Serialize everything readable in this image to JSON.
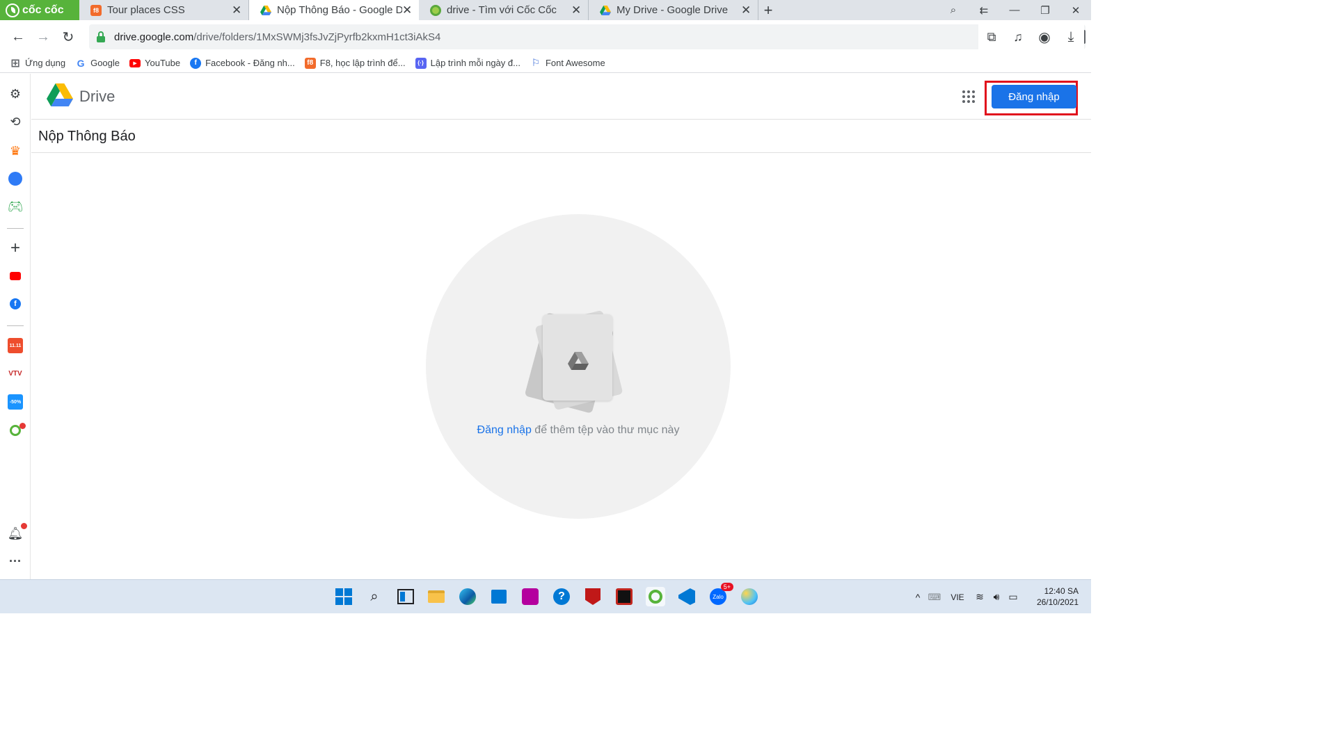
{
  "browser": {
    "brand": "cốc cốc",
    "tabs": [
      {
        "title": "Tour places CSS",
        "icon": "f8-icon",
        "active": false
      },
      {
        "title": "Nộp Thông Báo - Google Dri",
        "icon": "google-drive-icon",
        "active": true
      },
      {
        "title": "drive - Tìm với Cốc Cốc",
        "icon": "coccoc-icon",
        "active": false
      },
      {
        "title": "My Drive - Google Drive",
        "icon": "google-drive-icon",
        "active": false
      }
    ],
    "tab_close_glyph": "✕",
    "new_tab_glyph": "+",
    "url_host": "drive.google.com",
    "url_path": "/drive/folders/1MxSWMj3fsJvZjPyrfb2kxmH1ct3iAkS4",
    "bookmarks": [
      {
        "label": "Ứng dụng",
        "icon": "apps-icon"
      },
      {
        "label": "Google",
        "icon": "google-icon"
      },
      {
        "label": "YouTube",
        "icon": "youtube-icon"
      },
      {
        "label": "Facebook - Đăng nh...",
        "icon": "facebook-icon"
      },
      {
        "label": "F8, học lập trình để...",
        "icon": "f8-icon"
      },
      {
        "label": "Lập trình mỗi ngày đ...",
        "icon": "code-icon"
      },
      {
        "label": "Font Awesome",
        "icon": "flag-icon"
      }
    ]
  },
  "drive": {
    "app_name": "Drive",
    "signin_label": "Đăng nhập",
    "folder_title": "Nộp Thông Báo",
    "empty_link": "Đăng nhập",
    "empty_rest": " để thêm tệp vào thư mục này"
  },
  "taskbar": {
    "language": "VIE",
    "time": "12:40 SA",
    "date": "26/10/2021",
    "zalo_badge": "5+"
  },
  "colors": {
    "accent": "#1a73e8",
    "highlight_outline": "#e1111c",
    "coccoc_green": "#57b33b"
  }
}
